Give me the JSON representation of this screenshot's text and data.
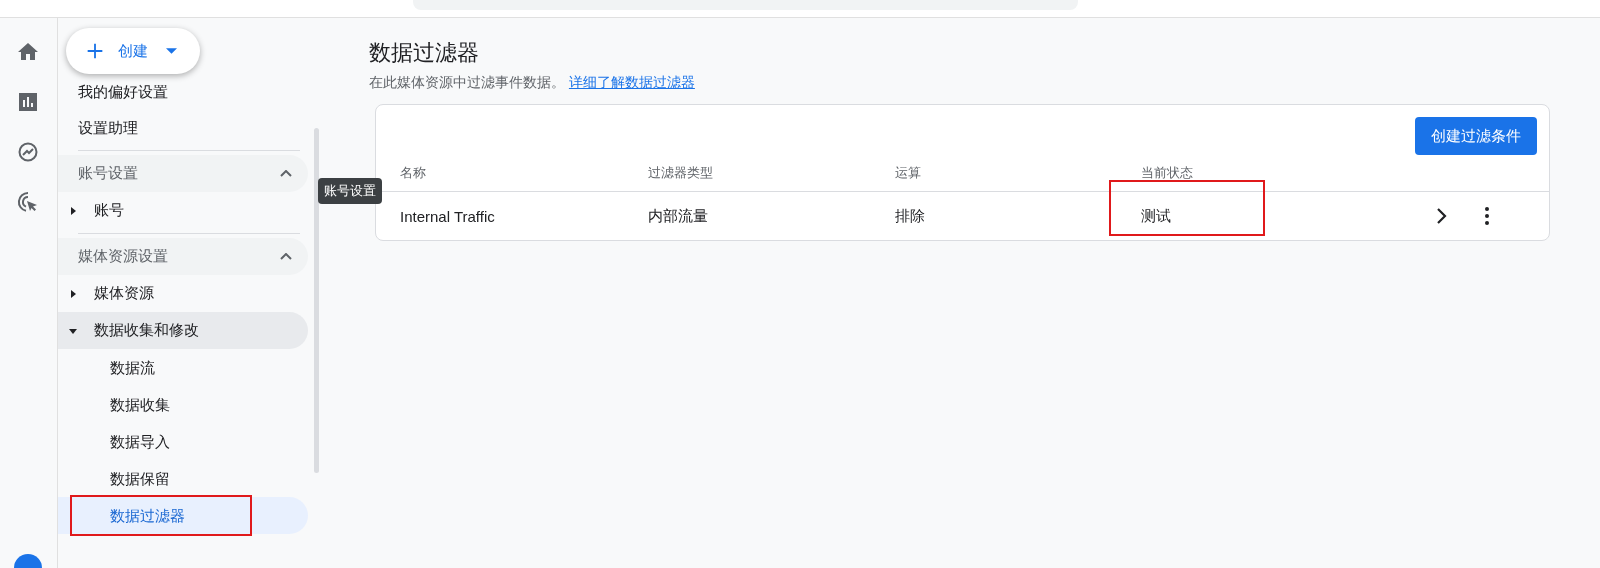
{
  "create_button": {
    "label": "创建"
  },
  "sidebar": {
    "items": [
      {
        "kind": "link",
        "label": "我的偏好设置"
      },
      {
        "kind": "link",
        "label": "设置助理"
      },
      {
        "kind": "section",
        "label": "账号设置",
        "expanded": true,
        "children": [
          {
            "label": "账号",
            "expanded": false,
            "highlighted": false
          }
        ]
      },
      {
        "kind": "section",
        "label": "媒体资源设置",
        "expanded": true,
        "children": [
          {
            "label": "媒体资源",
            "expanded": false,
            "highlighted": false
          },
          {
            "label": "数据收集和修改",
            "expanded": true,
            "highlighted": true,
            "children": [
              {
                "label": "数据流",
                "selected": false
              },
              {
                "label": "数据收集",
                "selected": false
              },
              {
                "label": "数据导入",
                "selected": false
              },
              {
                "label": "数据保留",
                "selected": false
              },
              {
                "label": "数据过滤器",
                "selected": true
              }
            ]
          }
        ]
      }
    ]
  },
  "tooltip": {
    "text": "账号设置"
  },
  "page": {
    "title": "数据过滤器",
    "description": "在此媒体资源中过滤事件数据。",
    "link": "详细了解数据过滤器"
  },
  "create_filter_button": {
    "label": "创建过滤条件"
  },
  "table": {
    "columns": [
      "名称",
      "过滤器类型",
      "运算",
      "当前状态"
    ],
    "rows": [
      {
        "cells": [
          "Internal Traffic",
          "内部流量",
          "排除",
          "测试"
        ]
      }
    ]
  }
}
